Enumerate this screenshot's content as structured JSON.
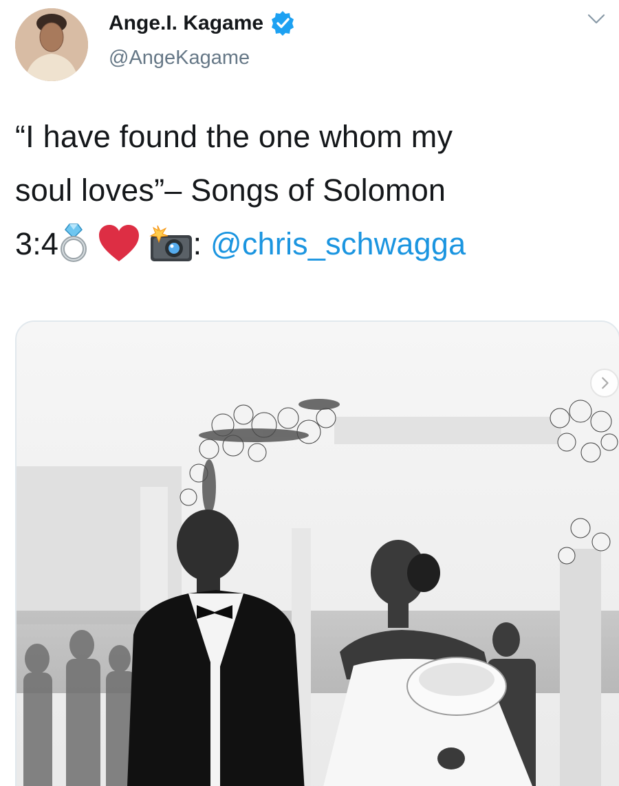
{
  "user": {
    "display_name": "Ange.I. Kagame",
    "handle": "@AngeKagame",
    "verified": true
  },
  "tweet": {
    "line1": "“I have found the one whom my",
    "line2": "soul loves”– Songs of Solomon",
    "line3_prefix": "3:4",
    "line3_sep": ":",
    "mention": "@chris_schwagga",
    "emojis": [
      "ring-icon",
      "red-heart-icon",
      "camera-with-flash-icon"
    ]
  },
  "colors": {
    "link": "#1b95e0",
    "verified": "#1da1f2",
    "secondary_text": "#657786"
  }
}
